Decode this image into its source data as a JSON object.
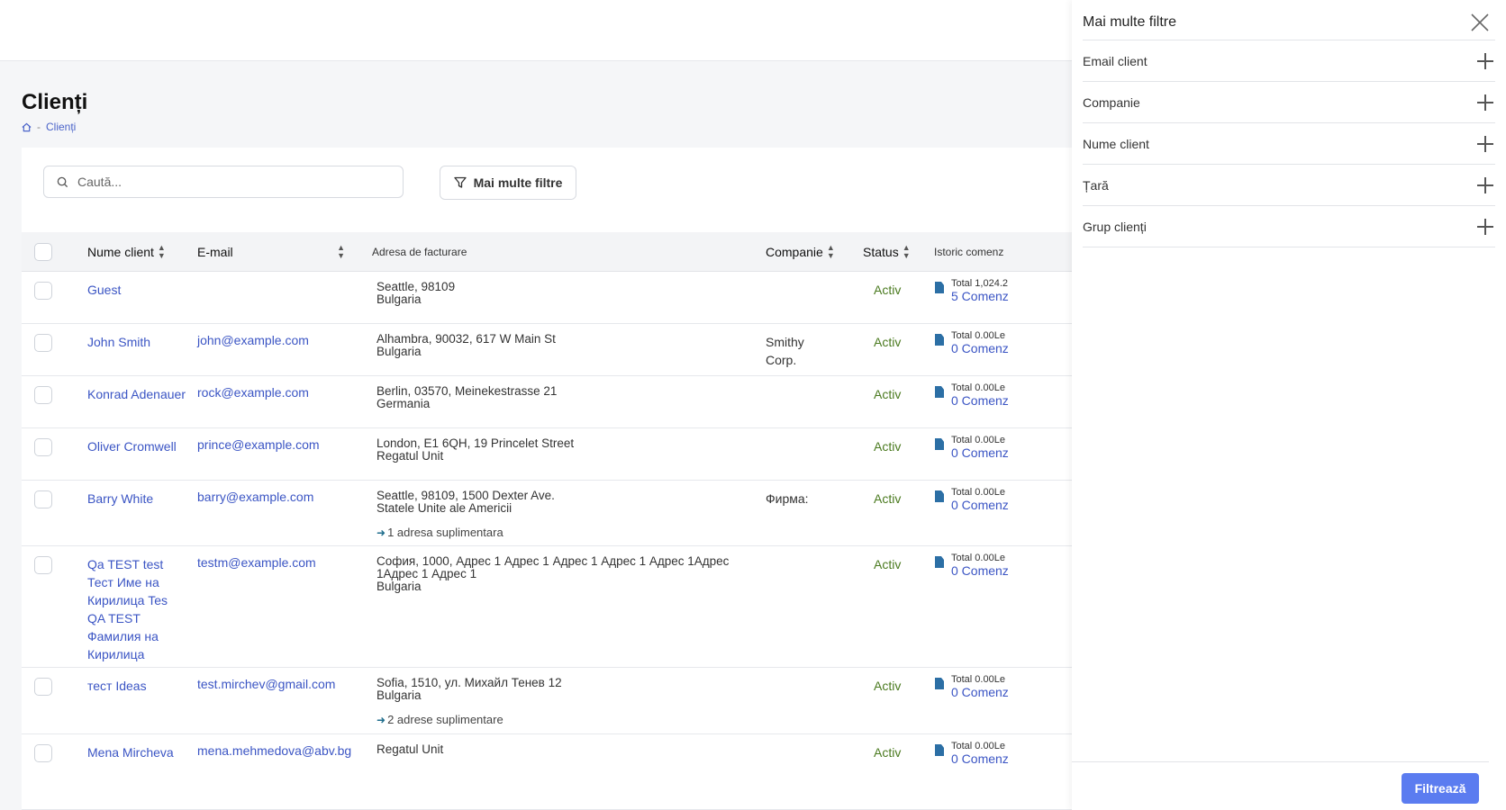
{
  "page": {
    "title": "Clienți"
  },
  "breadcrumb": {
    "home_icon": "home-icon",
    "separator": "-",
    "current": "Clienți"
  },
  "search": {
    "placeholder": "Caută..."
  },
  "toolbar": {
    "more_filters_label": "Mai multe filtre"
  },
  "table": {
    "headers": {
      "name": "Nume client",
      "email": "E-mail",
      "address": "Adresa de facturare",
      "company": "Companie",
      "status": "Status",
      "history": "Istoric comenz"
    },
    "rows": [
      {
        "name": "Guest",
        "email": "",
        "addr1": "Seattle, 98109",
        "addr2": "Bulgaria",
        "extra": "",
        "company": "",
        "status": "Activ",
        "total": "Total 1,024.2",
        "orders": "5 Comenz"
      },
      {
        "name": "John Smith",
        "email": "john@example.com",
        "addr1": "Alhambra, 90032, 617 W Main St",
        "addr2": "Bulgaria",
        "extra": "",
        "company": "Smithy Corp.",
        "status": "Activ",
        "total": "Total 0.00Le",
        "orders": "0 Comenz"
      },
      {
        "name": "Konrad Adenauer",
        "email": "rock@example.com",
        "addr1": "Berlin, 03570, Meinekestrasse 21",
        "addr2": "Germania",
        "extra": "",
        "company": "",
        "status": "Activ",
        "total": "Total 0.00Le",
        "orders": "0 Comenz"
      },
      {
        "name": "Oliver Cromwell",
        "email": "prince@example.com",
        "addr1": "London, E1 6QH, 19 Princelet Street",
        "addr2": "Regatul Unit",
        "extra": "",
        "company": "",
        "status": "Activ",
        "total": "Total 0.00Le",
        "orders": "0 Comenz"
      },
      {
        "name": "Barry White",
        "email": "barry@example.com",
        "addr1": "Seattle, 98109, 1500 Dexter Ave.",
        "addr2": "Statele Unite ale Americii",
        "extra": "1 adresa suplimentara",
        "company": "Фирма:",
        "status": "Activ",
        "total": "Total 0.00Le",
        "orders": "0 Comenz"
      },
      {
        "name": "Qa TEST test Тест Име на Кирилица Tes QA TEST Фамилия на Кирилица",
        "email": "testm@example.com",
        "addr1": "София, 1000, Адрес 1 Адрес 1 Адрес 1 Адрес 1 Адрес 1Адрес 1Адрес 1 Адрес 1",
        "addr2": "Bulgaria",
        "extra": "",
        "company": "",
        "status": "Activ",
        "total": "Total 0.00Le",
        "orders": "0 Comenz"
      },
      {
        "name": "тест Ideas",
        "email": "test.mirchev@gmail.com",
        "addr1": "Sofia, 1510, ул. Михайл Тенев 12",
        "addr2": "Bulgaria",
        "extra": "2 adrese suplimentare",
        "company": "",
        "status": "Activ",
        "total": "Total 0.00Le",
        "orders": "0 Comenz"
      },
      {
        "name": "Mena Mircheva",
        "email": "mena.mehmedova@abv.bg",
        "addr1": "Regatul Unit",
        "addr2": "",
        "extra": "",
        "company": "",
        "status": "Activ",
        "total": "Total 0.00Le",
        "orders": "0 Comenz"
      }
    ]
  },
  "panel": {
    "title": "Mai multe filtre",
    "filters": [
      "Email client",
      "Companie",
      "Nume client",
      "Țară",
      "Grup clienți"
    ],
    "apply_label": "Filtrează"
  },
  "colors": {
    "accent": "#5b7cf0",
    "link": "#3b55c4",
    "status_active": "#4a7a1f"
  }
}
